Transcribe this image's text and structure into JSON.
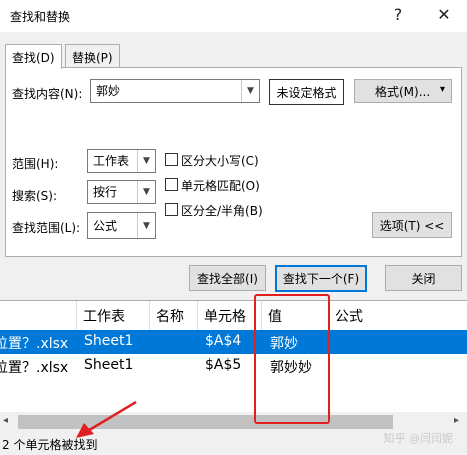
{
  "window": {
    "title": "查找和替换",
    "help_symbol": "?",
    "close_symbol": "✕"
  },
  "tabs": [
    {
      "label": "查找(D)"
    },
    {
      "label": "替换(P)"
    }
  ],
  "find": {
    "label": "查找内容(N):",
    "value": "郭妙",
    "format_status": "未设定格式",
    "format_button": "格式(M)...",
    "format_arrow": "▾"
  },
  "options": {
    "scope_label": "范围(H):",
    "scope_value": "工作表",
    "search_label": "搜索(S):",
    "search_value": "按行",
    "lookin_label": "查找范围(L):",
    "lookin_value": "公式",
    "match_case": "区分大小写(C)",
    "match_cell": "单元格匹配(O)",
    "match_width": "区分全/半角(B)",
    "options_button": "选项(T) <<"
  },
  "actions": {
    "find_all": "查找全部(I)",
    "find_next": "查找下一个(F)",
    "close": "关闭"
  },
  "results": {
    "columns": [
      "工作表",
      "名称",
      "单元格",
      "值",
      "公式"
    ],
    "rows": [
      {
        "book": "位置？.xlsx",
        "sheet": "Sheet1",
        "name": "",
        "cell": "$A$4",
        "value": "郭妙",
        "formula": ""
      },
      {
        "book": "位置？.xlsx",
        "sheet": "Sheet1",
        "name": "",
        "cell": "$A$5",
        "value": "郭妙妙",
        "formula": ""
      }
    ]
  },
  "status": {
    "text": "2 个单元格被找到"
  },
  "watermark": "知乎 @闫闫妮",
  "colors": {
    "selection": "#0078d7",
    "annotation": "#e02020"
  }
}
